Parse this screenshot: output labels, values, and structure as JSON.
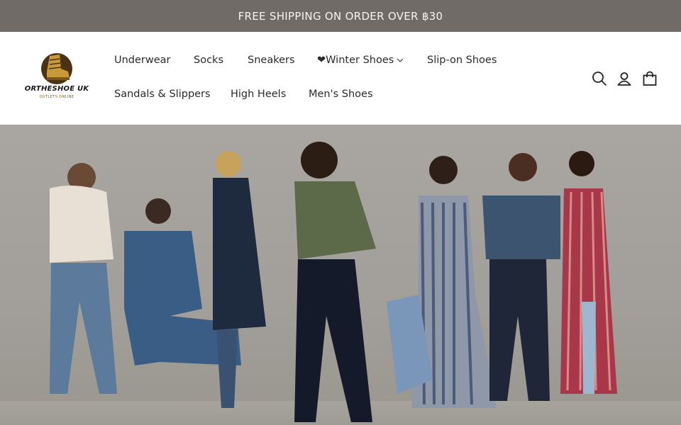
{
  "announcement": {
    "text": "FREE SHIPPING ON ORDER OVER ฿30"
  },
  "logo": {
    "name": "ORTHESHOE UK",
    "tagline": "OUTLETS ONLINE"
  },
  "nav": {
    "row1": [
      {
        "label": "Underwear"
      },
      {
        "label": "Socks"
      },
      {
        "label": "Sneakers"
      },
      {
        "label": "❤Winter Shoes",
        "has_dropdown": true
      },
      {
        "label": "Slip-on Shoes"
      }
    ],
    "row2": [
      {
        "label": "Sandals & Slippers"
      },
      {
        "label": "High Heels"
      },
      {
        "label": "Men's Shoes"
      }
    ]
  },
  "header_icons": [
    "search-icon",
    "account-icon",
    "cart-icon"
  ],
  "colors": {
    "announcement_bg": "#706b66",
    "announcement_text": "#f4f4f4",
    "nav_text": "#2a2a2a",
    "logo_brown": "#4a3214",
    "logo_gold": "#c99a3a"
  }
}
